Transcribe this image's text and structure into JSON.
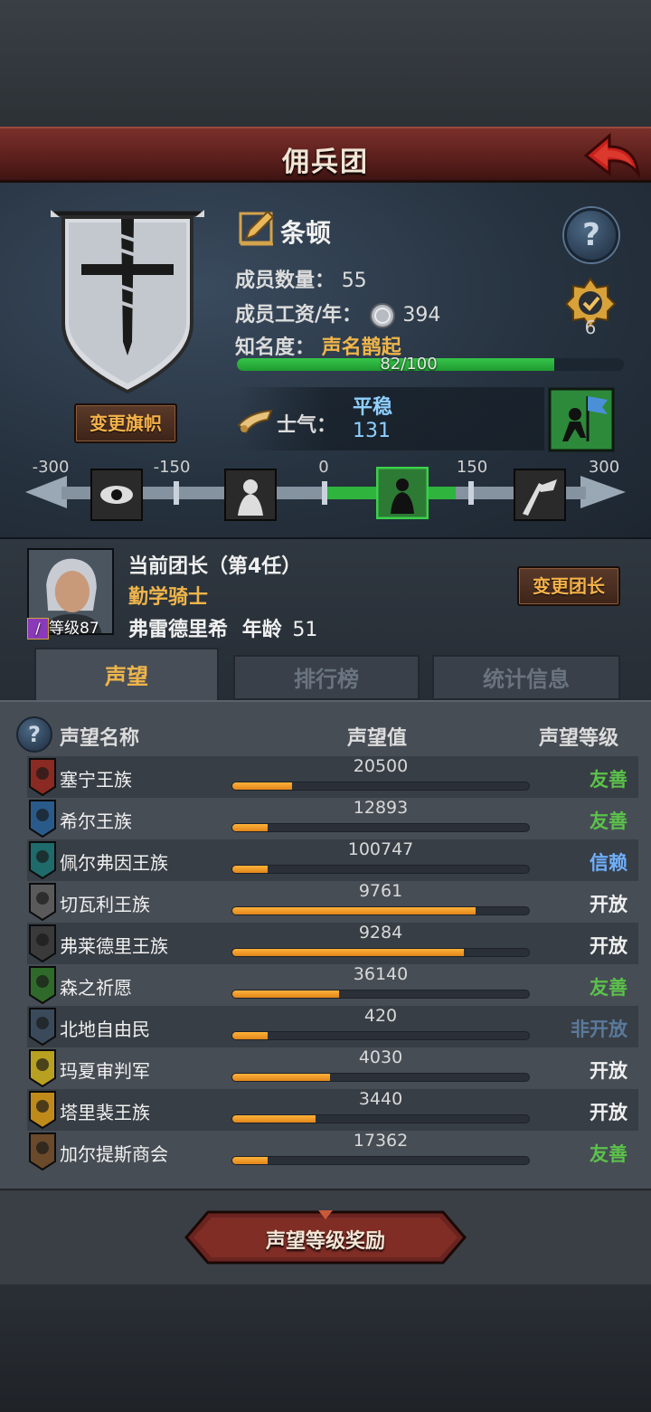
{
  "header": {
    "title": "佣兵团"
  },
  "company": {
    "name": "条顿",
    "change_banner_label": "变更旗帜",
    "members_label": "成员数量：",
    "members_value": "55",
    "wage_label": "成员工资/年：",
    "wage_value": "394",
    "fame_label": "知名度：",
    "fame_value": "声名鹊起",
    "fame_progress_text": "82/100",
    "fame_progress": 0.82,
    "badge_count": "6",
    "help_symbol": "?"
  },
  "morale": {
    "label": "士气：",
    "state": "平稳",
    "value": "131",
    "scale_labels": [
      "-300",
      "-150",
      "0",
      "150",
      "300"
    ]
  },
  "captain": {
    "title_line": "当前团长（第4任）",
    "class_line": "勤学骑士",
    "name": "弗雷德里希",
    "age_label": "年龄",
    "age_value": "51",
    "level_text": "等级87",
    "change_label": "变更团长"
  },
  "tabs": [
    {
      "label": "声望",
      "active": true
    },
    {
      "label": "排行榜",
      "active": false
    },
    {
      "label": "统计信息",
      "active": false
    }
  ],
  "list_header": {
    "name": "声望名称",
    "value": "声望值",
    "level": "声望等级",
    "help_symbol": "?"
  },
  "factions": [
    {
      "name": "塞宁王族",
      "rep": "20500",
      "fill": 0.2,
      "level": "友善",
      "color": "#5bc24a",
      "icon_bg": "#8a2a22"
    },
    {
      "name": "希尔王族",
      "rep": "12893",
      "fill": 0.12,
      "level": "友善",
      "color": "#5bc24a",
      "icon_bg": "#2a5a8a"
    },
    {
      "name": "佩尔弗因王族",
      "rep": "100747",
      "fill": 0.12,
      "level": "信赖",
      "color": "#6fb0ff",
      "icon_bg": "#1f6a6a"
    },
    {
      "name": "切瓦利王族",
      "rep": "9761",
      "fill": 0.82,
      "level": "开放",
      "color": "#f0f0f0",
      "icon_bg": "#5a5a5a"
    },
    {
      "name": "弗莱德里王族",
      "rep": "9284",
      "fill": 0.78,
      "level": "开放",
      "color": "#f0f0f0",
      "icon_bg": "#3a3a3a"
    },
    {
      "name": "森之祈愿",
      "rep": "36140",
      "fill": 0.36,
      "level": "友善",
      "color": "#5bc24a",
      "icon_bg": "#2f6a2a"
    },
    {
      "name": "北地自由民",
      "rep": "420",
      "fill": 0.12,
      "level": "非开放",
      "color": "#5a7a9c",
      "icon_bg": "#3a4a5a"
    },
    {
      "name": "玛夏审判军",
      "rep": "4030",
      "fill": 0.33,
      "level": "开放",
      "color": "#f0f0f0",
      "icon_bg": "#b8a020"
    },
    {
      "name": "塔里裴王族",
      "rep": "3440",
      "fill": 0.28,
      "level": "开放",
      "color": "#f0f0f0",
      "icon_bg": "#c08a1a"
    },
    {
      "name": "加尔提斯商会",
      "rep": "17362",
      "fill": 0.12,
      "level": "友善",
      "color": "#5bc24a",
      "icon_bg": "#6a4a2a"
    }
  ],
  "reward_button": {
    "label": "声望等级奖励"
  },
  "icons": {
    "back": "back-arrow-icon",
    "edit": "edit-pencil-icon",
    "silver_coin": "silver-coin-icon",
    "horn": "horn-icon",
    "badge": "rank-badge-icon",
    "morale_state": "morale-flag-icon"
  }
}
